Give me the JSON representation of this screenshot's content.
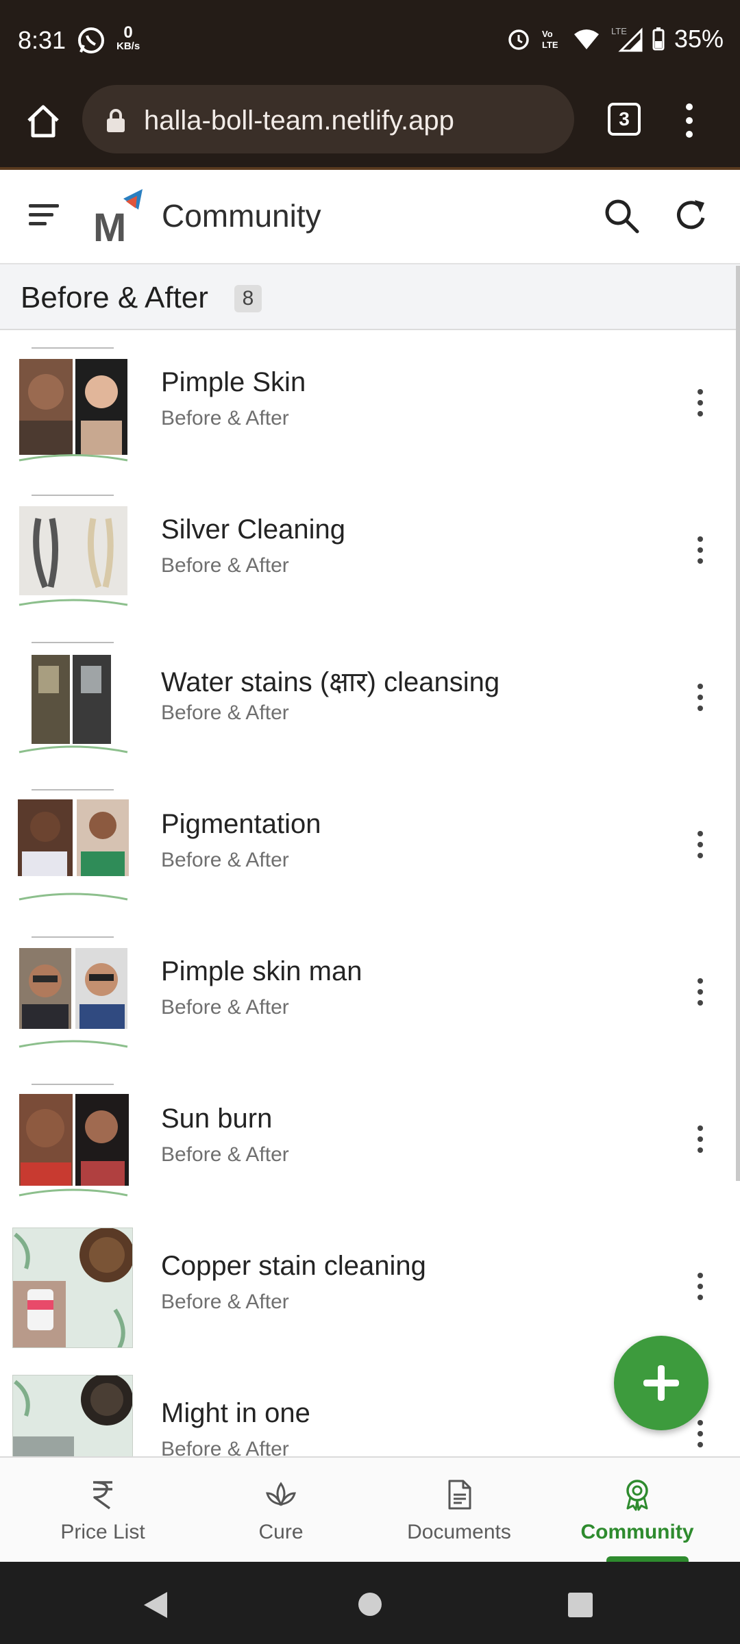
{
  "status": {
    "time": "8:31",
    "net_speed_value": "0",
    "net_speed_unit": "KB/s",
    "battery": "35%"
  },
  "browser": {
    "url": "halla-boll-team.netlify.app",
    "tab_count": "3"
  },
  "appbar": {
    "title": "Community"
  },
  "section": {
    "title": "Before & After",
    "count": "8"
  },
  "items": [
    {
      "title": "Pimple Skin",
      "subtitle": "Before & After"
    },
    {
      "title": "Silver Cleaning",
      "subtitle": "Before & After"
    },
    {
      "title": "Water stains (क्षार) cleansing",
      "subtitle": "Before & After"
    },
    {
      "title": "Pigmentation",
      "subtitle": "Before & After"
    },
    {
      "title": "Pimple skin man",
      "subtitle": "Before & After"
    },
    {
      "title": "Sun burn",
      "subtitle": "Before & After"
    },
    {
      "title": "Copper stain cleaning",
      "subtitle": "Before & After"
    },
    {
      "title": "Might in one",
      "subtitle": "Before & After"
    }
  ],
  "bottom_nav": [
    {
      "label": "Price List",
      "icon": "rupee-icon"
    },
    {
      "label": "Cure",
      "icon": "lotus-icon"
    },
    {
      "label": "Documents",
      "icon": "document-icon"
    },
    {
      "label": "Community",
      "icon": "award-icon",
      "active": true
    }
  ],
  "colors": {
    "accent": "#3d9b3d",
    "browser_bar": "#241c17",
    "active_nav": "#2e8b2e"
  }
}
